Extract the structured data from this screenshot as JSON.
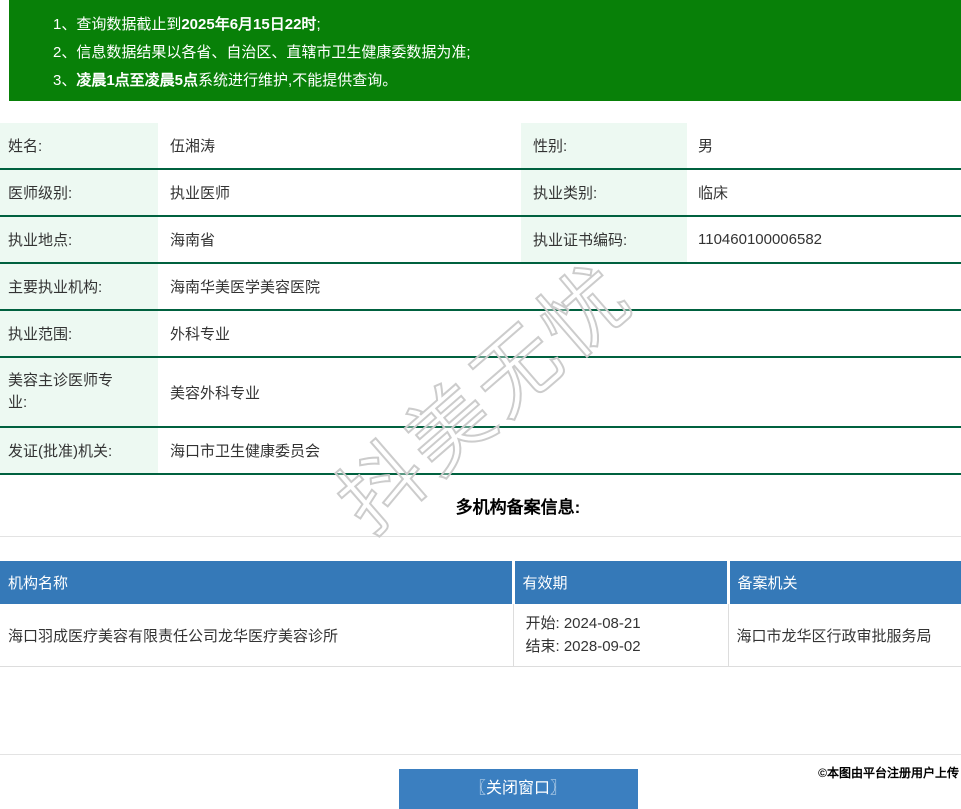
{
  "banner": {
    "lines": [
      {
        "pre": "1、查询数据截止到",
        "bold": "2025年6月15日22时",
        "post": ";"
      },
      {
        "pre": "2、信息数据结果以各省、自治区、直辖市卫生健康委数据为准;",
        "bold": "",
        "post": ""
      },
      {
        "pre": "3、",
        "bold": "凌晨1点至凌晨5点",
        "post": "系统进行维护,不能提供查询。"
      }
    ]
  },
  "doctor_info": {
    "rows_paired": [
      {
        "label1": "姓名:",
        "value1": "伍湘涛",
        "label2": "性别:",
        "value2": "男"
      },
      {
        "label1": "医师级别:",
        "value1": "执业医师",
        "label2": "执业类别:",
        "value2": "临床"
      },
      {
        "label1": "执业地点:",
        "value1": "海南省",
        "label2": "执业证书编码:",
        "value2": "110460100006582"
      }
    ],
    "rows_full": [
      {
        "label": "主要执业机构:",
        "value": "海南华美医学美容医院"
      },
      {
        "label": "执业范围:",
        "value": "外科专业"
      },
      {
        "label": "美容主诊医师专业:",
        "value": "美容外科专业"
      },
      {
        "label": "发证(批准)机关:",
        "value": "海口市卫生健康委员会"
      }
    ]
  },
  "multi_org": {
    "heading": "多机构备案信息:",
    "headers": [
      "机构名称",
      "有效期",
      "备案机关"
    ],
    "rows": [
      {
        "name": "海口羽成医疗美容有限责任公司龙华医疗美容诊所",
        "start_label": "开始:",
        "start_date": "2024-08-21",
        "end_label": "结束:",
        "end_date": "2028-09-02",
        "authority": "海口市龙华区行政审批服务局"
      }
    ]
  },
  "footer": {
    "close_button": "〖关闭窗口〗",
    "credit": "©本图由平台注册用户上传"
  },
  "watermark": "抖美无忧",
  "colors": {
    "banner_green": "#088008",
    "row_border_green": "#00613f",
    "label_bg_mint": "#edf9f2",
    "table_header_blue": "#3579b8",
    "button_blue": "#3b7fc0"
  }
}
